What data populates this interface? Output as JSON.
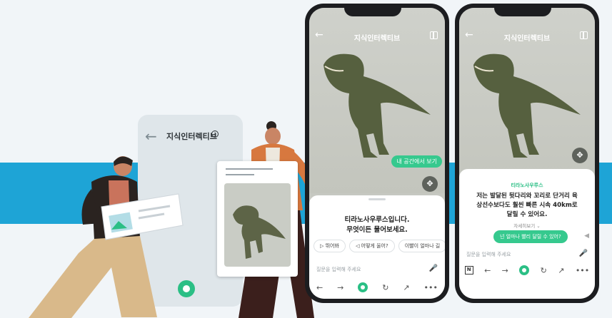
{
  "panel": {
    "title": "지식인터렉티브"
  },
  "phones": [
    {
      "header_title": "지식인터렉티브",
      "ar_button": "내 공간에서 보기",
      "intro_lines": [
        "티라노사우루스입니다.",
        "무엇이든 물어보세요."
      ],
      "chips": [
        "뛰어봐",
        "어떻게 울어?",
        "이빨이 얼마나 길"
      ],
      "input_placeholder": "질문을 입력해 주세요"
    },
    {
      "header_title": "지식인터렉티브",
      "answer_tag": "티라노사우루스",
      "answer_lines": [
        "저는 발달된 뒷다리와 꼬리로 단거리 육",
        "상선수보다도 훨씬 빠른 시속 40km로",
        "달릴 수 있어요."
      ],
      "more_label": "자세히보기",
      "followup": "넌 얼마나 빨리 달릴 수 있어?",
      "input_placeholder": "질문을 입력해 주세요",
      "brand_badge": "N"
    }
  ],
  "colors": {
    "accent": "#2bbf85",
    "band": "#1ea4d6"
  },
  "icons": [
    "back-arrow-icon",
    "info-icon",
    "grid-icon",
    "rotate-icon",
    "mic-icon",
    "forward-icon",
    "refresh-icon",
    "share-icon",
    "more-icon",
    "speaker-icon"
  ]
}
